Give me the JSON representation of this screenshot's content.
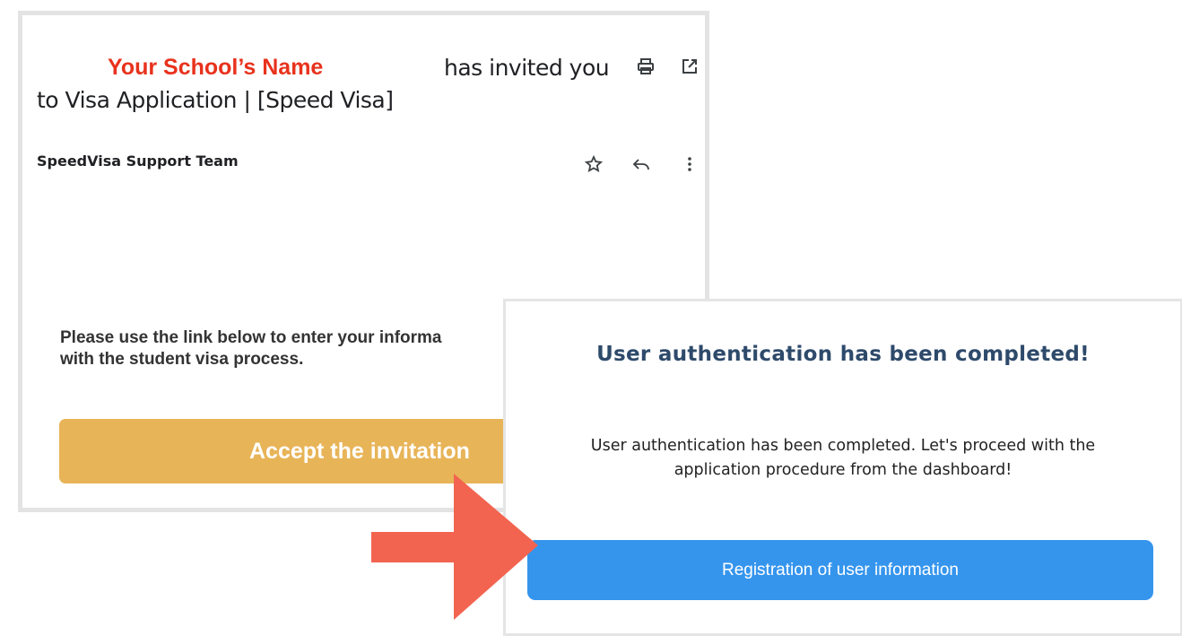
{
  "email": {
    "school_name": "Your School’s Name",
    "subject_part1": "has invited you",
    "subject_part2": "to Visa Application | [Speed Visa]",
    "sender": "SpeedVisa Support Team",
    "body_line1": "Please use the link below to enter your informa",
    "body_line2": "with the student visa process.",
    "accept_label": "Accept the invitation",
    "icons": [
      "print-icon",
      "open-in-new-icon",
      "star-icon",
      "reply-icon",
      "more-vert-icon"
    ]
  },
  "auth": {
    "title": "User authentication has been completed!",
    "message_line1": "User authentication has been completed. Let's proceed with the",
    "message_line2": "application procedure from the dashboard!",
    "register_label": "Registration of user information"
  },
  "colors": {
    "school_name": "#e8321c",
    "accept_button": "#e8b458",
    "register_button": "#3595ed",
    "auth_title": "#2e4a6b",
    "arrow": "#f26450"
  }
}
